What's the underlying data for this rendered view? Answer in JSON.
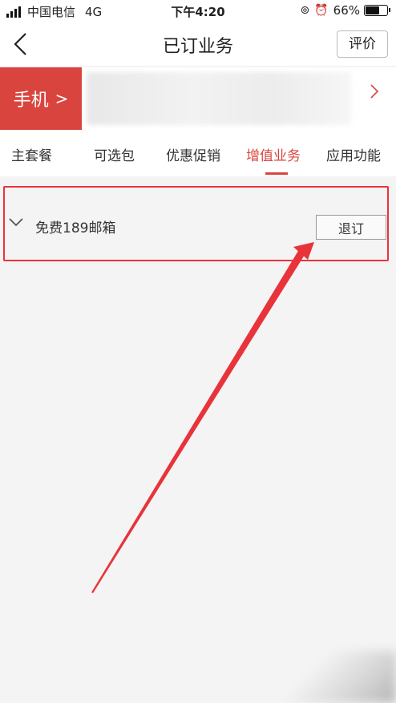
{
  "status_bar": {
    "carrier": "中国电信",
    "network": "4G",
    "time": "下午4:20",
    "battery_text": "66%",
    "battery_level": 0.66
  },
  "nav": {
    "title": "已订业务",
    "rate_label": "评价"
  },
  "account": {
    "phone_label": "手机",
    "phone_arrow": ">"
  },
  "tabs": [
    {
      "label": "主套餐"
    },
    {
      "label": "可选包"
    },
    {
      "label": "优惠促销"
    },
    {
      "label": "增值业务",
      "active": true
    },
    {
      "label": "应用功能"
    }
  ],
  "services": [
    {
      "name": "免费189邮箱",
      "action_label": "退订"
    }
  ],
  "colors": {
    "brand_red": "#d9453e",
    "annotation_red": "#e8333a",
    "background": "#f4f4f4"
  },
  "icons": [
    "back-icon",
    "chevron-right-icon",
    "chevron-down-icon",
    "alarm-icon",
    "rotation-lock-icon",
    "battery-icon",
    "signal-icon"
  ]
}
